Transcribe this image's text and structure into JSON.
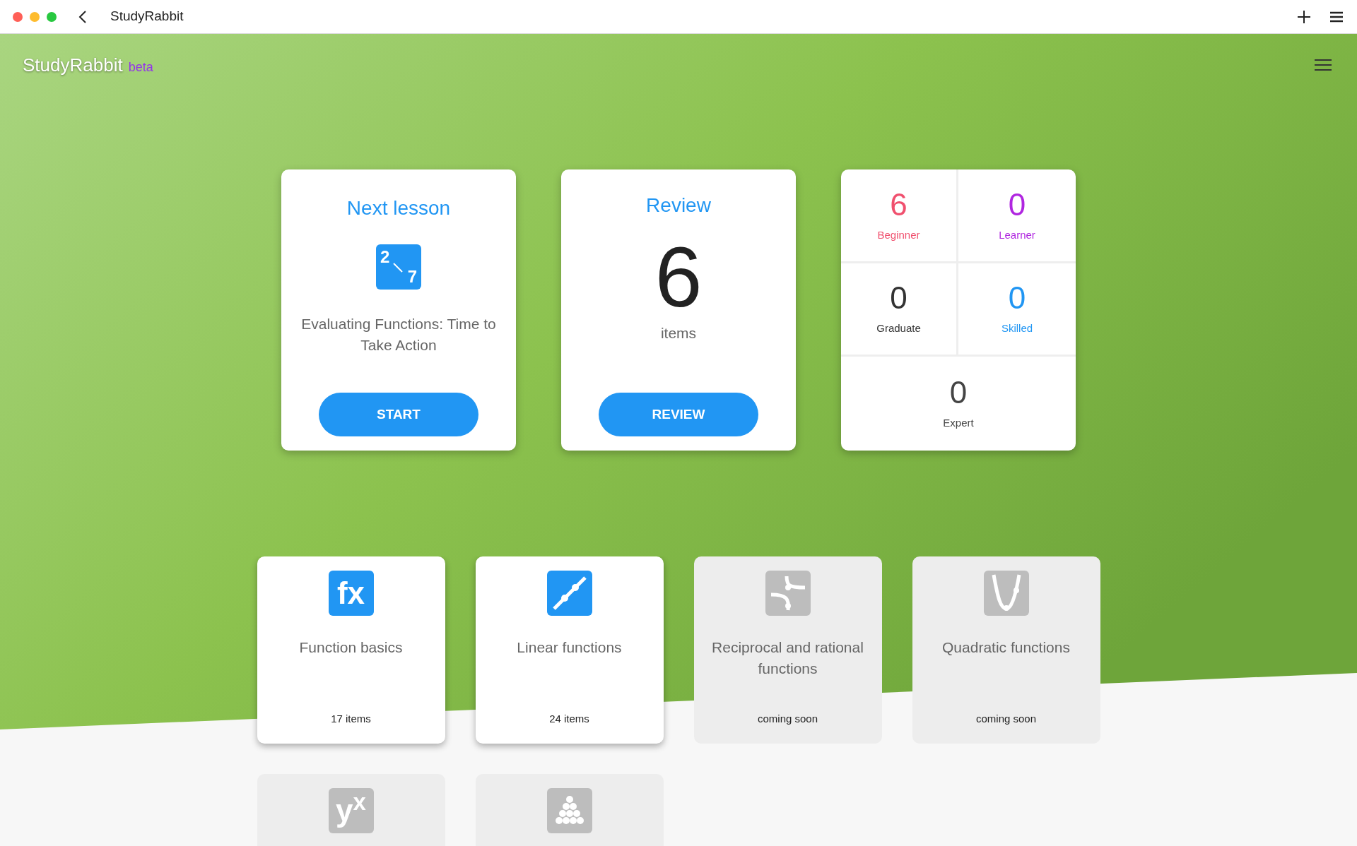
{
  "window": {
    "title": "StudyRabbit"
  },
  "header": {
    "brand": "StudyRabbit",
    "badge": "beta"
  },
  "next_lesson": {
    "title": "Next lesson",
    "icon_digits": [
      "2",
      "7"
    ],
    "lesson": "Evaluating Functions: Time to Take Action",
    "button": "START"
  },
  "review": {
    "title": "Review",
    "count": "6",
    "unit": "items",
    "button": "REVIEW"
  },
  "levels": [
    {
      "count": "6",
      "label": "Beginner",
      "color": "#f0506e"
    },
    {
      "count": "0",
      "label": "Learner",
      "color": "#b026e0"
    },
    {
      "count": "0",
      "label": "Graduate",
      "color": "#333333"
    },
    {
      "count": "0",
      "label": "Skilled",
      "color": "#2196f3"
    },
    {
      "count": "0",
      "label": "Expert",
      "color": "#444444"
    }
  ],
  "topics": [
    {
      "kind": "fx",
      "icon_text": "fx",
      "title": "Function basics",
      "subtitle": "17 items",
      "available": true
    },
    {
      "kind": "line",
      "title": "Linear functions",
      "subtitle": "24 items",
      "available": true
    },
    {
      "kind": "reciprocal",
      "title": "Reciprocal and rational functions",
      "subtitle": "coming soon",
      "available": false
    },
    {
      "kind": "parabola",
      "title": "Quadratic functions",
      "subtitle": "coming soon",
      "available": false
    },
    {
      "kind": "power",
      "icon_text": "y$^{x}$",
      "available": false
    },
    {
      "kind": "dots",
      "available": false
    }
  ]
}
